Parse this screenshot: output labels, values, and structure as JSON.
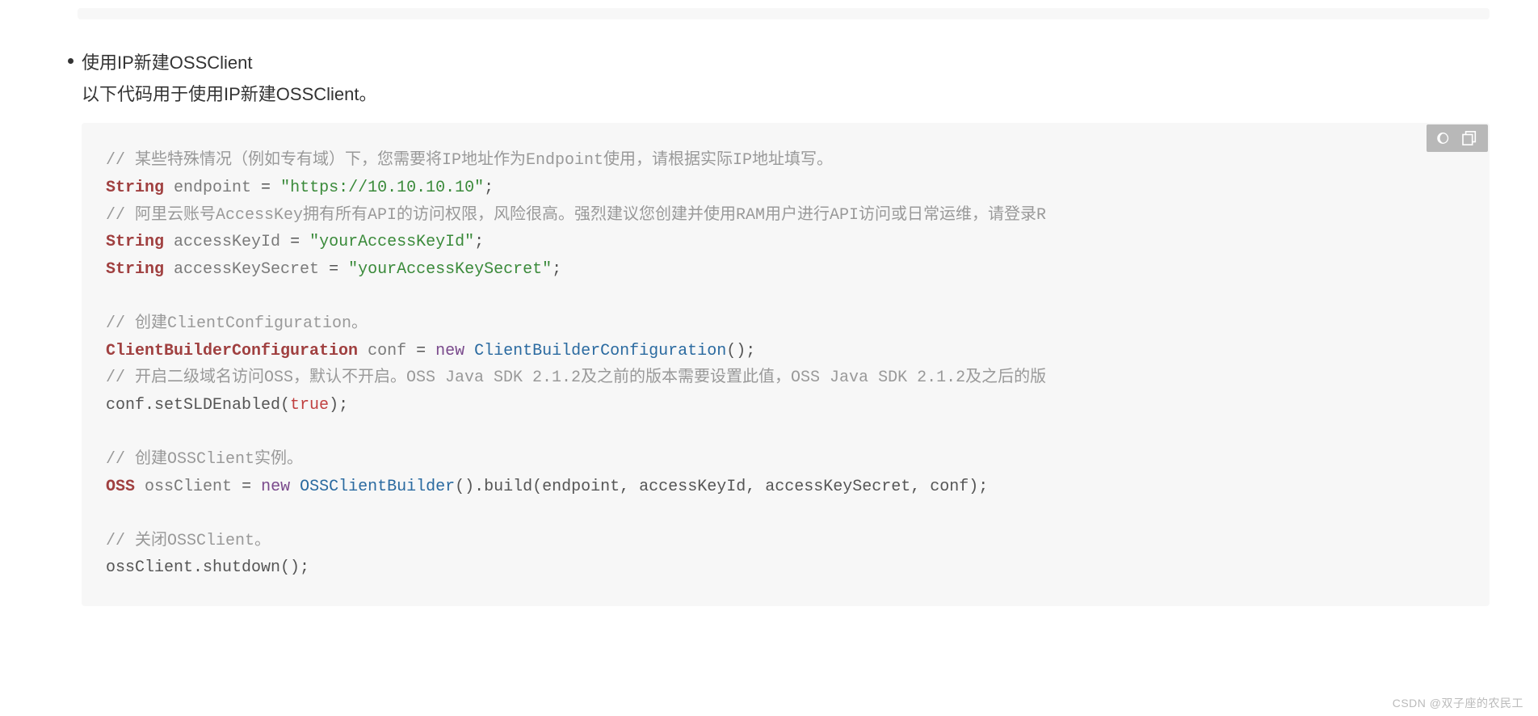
{
  "bullet": {
    "title": "使用IP新建OSSClient",
    "desc": "以下代码用于使用IP新建OSSClient。"
  },
  "toolbar": {
    "theme_label": "toggle-theme",
    "copy_label": "copy-code"
  },
  "code": {
    "c1": "// 某些特殊情况（例如专有域）下，您需要将IP地址作为Endpoint使用，请根据实际IP地址填写。",
    "l2_kw": "String",
    "l2_id": "endpoint",
    "l2_eq": " = ",
    "l2_str": "\"https://10.10.10.10\"",
    "l2_end": ";",
    "c3": "// 阿里云账号AccessKey拥有所有API的访问权限，风险很高。强烈建议您创建并使用RAM用户进行API访问或日常运维，请登录R",
    "l4_kw": "String",
    "l4_id": "accessKeyId",
    "l4_eq": " = ",
    "l4_str": "\"yourAccessKeyId\"",
    "l4_end": ";",
    "l5_kw": "String",
    "l5_id": "accessKeySecret",
    "l5_eq": " = ",
    "l5_str": "\"yourAccessKeySecret\"",
    "l5_end": ";",
    "c6": "// 创建ClientConfiguration。",
    "l7_typ1": "ClientBuilderConfiguration",
    "l7_id": "conf",
    "l7_eq": " = ",
    "l7_new": "new",
    "l7_typ2": "ClientBuilderConfiguration",
    "l7_end": "();",
    "c8": "// 开启二级域名访问OSS，默认不开启。OSS Java SDK 2.1.2及之前的版本需要设置此值，OSS Java SDK 2.1.2及之后的版",
    "l9_a": "conf.setSLDEnabled(",
    "l9_b": "true",
    "l9_c": ");",
    "c10": "// 创建OSSClient实例。",
    "l11_typ": "OSS",
    "l11_id": "ossClient",
    "l11_eq": " = ",
    "l11_new": "new",
    "l11_typ2": "OSSClientBuilder",
    "l11_end": "().build(endpoint, accessKeyId, accessKeySecret, conf);",
    "c12": "// 关闭OSSClient。",
    "l13": "ossClient.shutdown();"
  },
  "watermark": "CSDN @双子座的农民工"
}
